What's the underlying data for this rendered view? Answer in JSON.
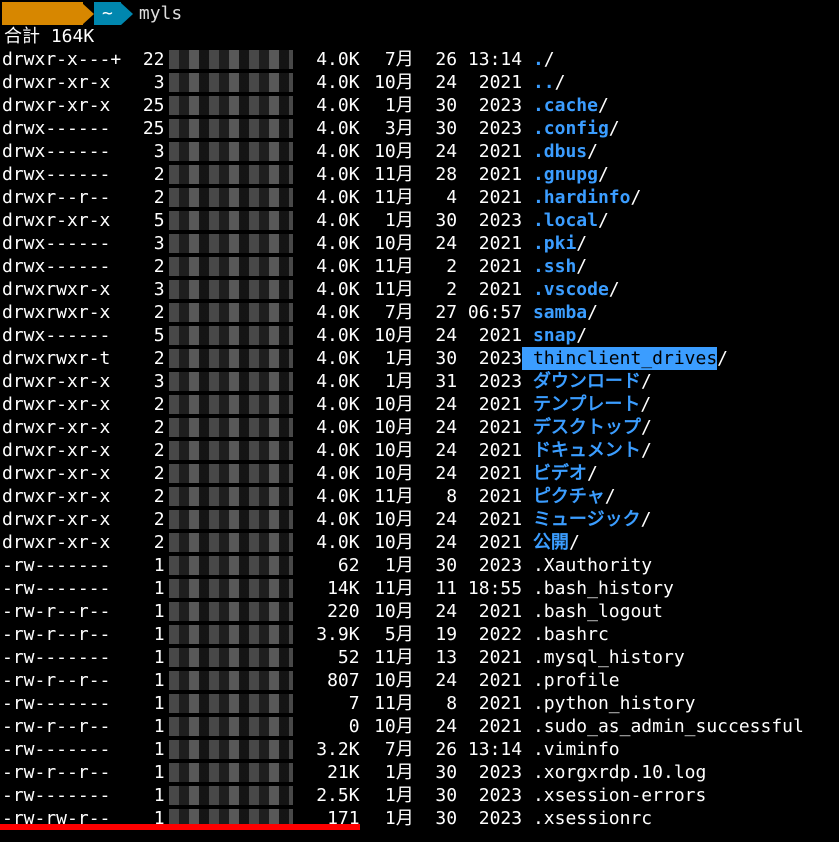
{
  "prompt": {
    "seg1_blurred": "      ",
    "seg2_home": "~",
    "command": "myls"
  },
  "total": {
    "label": "合計",
    "value": "164K"
  },
  "rows": [
    {
      "perm": "drwxr-x---+",
      "links": "22",
      "size": "4.0K",
      "month": "7月",
      "day": "26",
      "time": "13:14",
      "name": ".",
      "suffix": "/",
      "style": "dir"
    },
    {
      "perm": "drwxr-xr-x",
      "links": "3",
      "size": "4.0K",
      "month": "10月",
      "day": "24",
      "time": "2021",
      "name": "..",
      "suffix": "/",
      "style": "dir"
    },
    {
      "perm": "drwxr-xr-x",
      "links": "25",
      "size": "4.0K",
      "month": "1月",
      "day": "30",
      "time": "2023",
      "name": ".cache",
      "suffix": "/",
      "style": "dir"
    },
    {
      "perm": "drwx------",
      "links": "25",
      "size": "4.0K",
      "month": "3月",
      "day": "30",
      "time": "2023",
      "name": ".config",
      "suffix": "/",
      "style": "dir"
    },
    {
      "perm": "drwx------",
      "links": "3",
      "size": "4.0K",
      "month": "10月",
      "day": "24",
      "time": "2021",
      "name": ".dbus",
      "suffix": "/",
      "style": "dir"
    },
    {
      "perm": "drwx------",
      "links": "2",
      "size": "4.0K",
      "month": "11月",
      "day": "28",
      "time": "2021",
      "name": ".gnupg",
      "suffix": "/",
      "style": "dir"
    },
    {
      "perm": "drwxr--r--",
      "links": "2",
      "size": "4.0K",
      "month": "11月",
      "day": "4",
      "time": "2021",
      "name": ".hardinfo",
      "suffix": "/",
      "style": "dir"
    },
    {
      "perm": "drwxr-xr-x",
      "links": "5",
      "size": "4.0K",
      "month": "1月",
      "day": "30",
      "time": "2023",
      "name": ".local",
      "suffix": "/",
      "style": "dir"
    },
    {
      "perm": "drwx------",
      "links": "3",
      "size": "4.0K",
      "month": "10月",
      "day": "24",
      "time": "2021",
      "name": ".pki",
      "suffix": "/",
      "style": "dir"
    },
    {
      "perm": "drwx------",
      "links": "2",
      "size": "4.0K",
      "month": "11月",
      "day": "2",
      "time": "2021",
      "name": ".ssh",
      "suffix": "/",
      "style": "dir"
    },
    {
      "perm": "drwxrwxr-x",
      "links": "3",
      "size": "4.0K",
      "month": "11月",
      "day": "2",
      "time": "2021",
      "name": ".vscode",
      "suffix": "/",
      "style": "dir"
    },
    {
      "perm": "drwxrwxr-x",
      "links": "2",
      "size": "4.0K",
      "month": "7月",
      "day": "27",
      "time": "06:57",
      "name": "samba",
      "suffix": "/",
      "style": "dir"
    },
    {
      "perm": "drwx------",
      "links": "5",
      "size": "4.0K",
      "month": "10月",
      "day": "24",
      "time": "2021",
      "name": "snap",
      "suffix": "/",
      "style": "dir"
    },
    {
      "perm": "drwxrwxr-t",
      "links": "2",
      "size": "4.0K",
      "month": "1月",
      "day": "30",
      "time": "2023",
      "name": "thinclient_drives",
      "suffix": "/",
      "style": "hl"
    },
    {
      "perm": "drwxr-xr-x",
      "links": "3",
      "size": "4.0K",
      "month": "1月",
      "day": "31",
      "time": "2023",
      "name": "ダウンロード",
      "suffix": "/",
      "style": "dir"
    },
    {
      "perm": "drwxr-xr-x",
      "links": "2",
      "size": "4.0K",
      "month": "10月",
      "day": "24",
      "time": "2021",
      "name": "テンプレート",
      "suffix": "/",
      "style": "dir"
    },
    {
      "perm": "drwxr-xr-x",
      "links": "2",
      "size": "4.0K",
      "month": "10月",
      "day": "24",
      "time": "2021",
      "name": "デスクトップ",
      "suffix": "/",
      "style": "dir"
    },
    {
      "perm": "drwxr-xr-x",
      "links": "2",
      "size": "4.0K",
      "month": "10月",
      "day": "24",
      "time": "2021",
      "name": "ドキュメント",
      "suffix": "/",
      "style": "dir"
    },
    {
      "perm": "drwxr-xr-x",
      "links": "2",
      "size": "4.0K",
      "month": "10月",
      "day": "24",
      "time": "2021",
      "name": "ビデオ",
      "suffix": "/",
      "style": "dir"
    },
    {
      "perm": "drwxr-xr-x",
      "links": "2",
      "size": "4.0K",
      "month": "11月",
      "day": "8",
      "time": "2021",
      "name": "ピクチャ",
      "suffix": "/",
      "style": "dir"
    },
    {
      "perm": "drwxr-xr-x",
      "links": "2",
      "size": "4.0K",
      "month": "10月",
      "day": "24",
      "time": "2021",
      "name": "ミュージック",
      "suffix": "/",
      "style": "dir"
    },
    {
      "perm": "drwxr-xr-x",
      "links": "2",
      "size": "4.0K",
      "month": "10月",
      "day": "24",
      "time": "2021",
      "name": "公開",
      "suffix": "/",
      "style": "dir"
    },
    {
      "perm": "-rw-------",
      "links": "1",
      "size": "62",
      "month": "1月",
      "day": "30",
      "time": "2023",
      "name": ".Xauthority",
      "suffix": "",
      "style": "file"
    },
    {
      "perm": "-rw-------",
      "links": "1",
      "size": "14K",
      "month": "11月",
      "day": "11",
      "time": "18:55",
      "name": ".bash_history",
      "suffix": "",
      "style": "file"
    },
    {
      "perm": "-rw-r--r--",
      "links": "1",
      "size": "220",
      "month": "10月",
      "day": "24",
      "time": "2021",
      "name": ".bash_logout",
      "suffix": "",
      "style": "file"
    },
    {
      "perm": "-rw-r--r--",
      "links": "1",
      "size": "3.9K",
      "month": "5月",
      "day": "19",
      "time": "2022",
      "name": ".bashrc",
      "suffix": "",
      "style": "file"
    },
    {
      "perm": "-rw-------",
      "links": "1",
      "size": "52",
      "month": "11月",
      "day": "13",
      "time": "2021",
      "name": ".mysql_history",
      "suffix": "",
      "style": "file"
    },
    {
      "perm": "-rw-r--r--",
      "links": "1",
      "size": "807",
      "month": "10月",
      "day": "24",
      "time": "2021",
      "name": ".profile",
      "suffix": "",
      "style": "file"
    },
    {
      "perm": "-rw-------",
      "links": "1",
      "size": "7",
      "month": "11月",
      "day": "8",
      "time": "2021",
      "name": ".python_history",
      "suffix": "",
      "style": "file"
    },
    {
      "perm": "-rw-r--r--",
      "links": "1",
      "size": "0",
      "month": "10月",
      "day": "24",
      "time": "2021",
      "name": ".sudo_as_admin_successful",
      "suffix": "",
      "style": "file"
    },
    {
      "perm": "-rw-------",
      "links": "1",
      "size": "3.2K",
      "month": "7月",
      "day": "26",
      "time": "13:14",
      "name": ".viminfo",
      "suffix": "",
      "style": "file"
    },
    {
      "perm": "-rw-r--r--",
      "links": "1",
      "size": "21K",
      "month": "1月",
      "day": "30",
      "time": "2023",
      "name": ".xorgxrdp.10.log",
      "suffix": "",
      "style": "file"
    },
    {
      "perm": "-rw-------",
      "links": "1",
      "size": "2.5K",
      "month": "1月",
      "day": "30",
      "time": "2023",
      "name": ".xsession-errors",
      "suffix": "",
      "style": "file"
    },
    {
      "perm": "-rw-rw-r--",
      "links": "1",
      "size": "171",
      "month": "1月",
      "day": "30",
      "time": "2023",
      "name": ".xsessionrc",
      "suffix": "",
      "style": "file"
    }
  ]
}
